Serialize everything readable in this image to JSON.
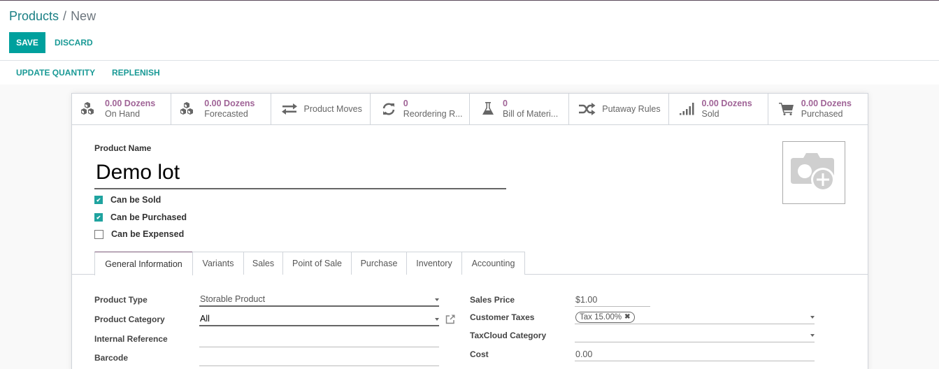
{
  "breadcrumb": {
    "parent": "Products",
    "separator": "/",
    "current": "New"
  },
  "actions": {
    "save_label": "SAVE",
    "discard_label": "DISCARD"
  },
  "statusbar": {
    "buttons": [
      "UPDATE QUANTITY",
      "REPLENISH"
    ]
  },
  "smart_buttons": [
    {
      "icon": "cubes-icon",
      "value": "0.00 Dozens",
      "label": "On Hand"
    },
    {
      "icon": "cubes-icon",
      "value": "0.00 Dozens",
      "label": "Forecasted"
    },
    {
      "icon": "exchange-icon",
      "value": null,
      "label": "Product Moves"
    },
    {
      "icon": "refresh-icon",
      "value": "0",
      "label": "Reordering R..."
    },
    {
      "icon": "flask-icon",
      "value": "0",
      "label": "Bill of Materi..."
    },
    {
      "icon": "random-icon",
      "value": null,
      "label": "Putaway Rules"
    },
    {
      "icon": "signal-icon",
      "value": "0.00 Dozens",
      "label": "Sold"
    },
    {
      "icon": "cart-icon",
      "value": "0.00 Dozens",
      "label": "Purchased"
    }
  ],
  "product": {
    "name_label": "Product Name",
    "name_value": "Demo lot",
    "checkboxes": [
      {
        "label": "Can be Sold",
        "checked": true
      },
      {
        "label": "Can be Purchased",
        "checked": true
      },
      {
        "label": "Can be Expensed",
        "checked": false
      }
    ]
  },
  "tabs": [
    "General Information",
    "Variants",
    "Sales",
    "Point of Sale",
    "Purchase",
    "Inventory",
    "Accounting"
  ],
  "active_tab": "General Information",
  "general": {
    "left": [
      {
        "label": "Product Type",
        "value": "Storable Product",
        "type": "select"
      },
      {
        "label": "Product Category",
        "value": "All",
        "type": "many2one"
      },
      {
        "label": "Internal Reference",
        "value": "",
        "type": "text"
      },
      {
        "label": "Barcode",
        "value": "",
        "type": "text"
      }
    ],
    "right": [
      {
        "label": "Sales Price",
        "value": "$1.00",
        "type": "monetary"
      },
      {
        "label": "Customer Taxes",
        "tags": [
          "Tax 15.00%"
        ],
        "type": "many2many"
      },
      {
        "label": "TaxCloud Category",
        "value": "",
        "type": "select"
      },
      {
        "label": "Cost",
        "value": "0.00",
        "type": "monetary"
      }
    ]
  },
  "colors": {
    "primary": "#00a09d",
    "brand_purple": "#875a7b",
    "stat_value": "#a06497"
  }
}
